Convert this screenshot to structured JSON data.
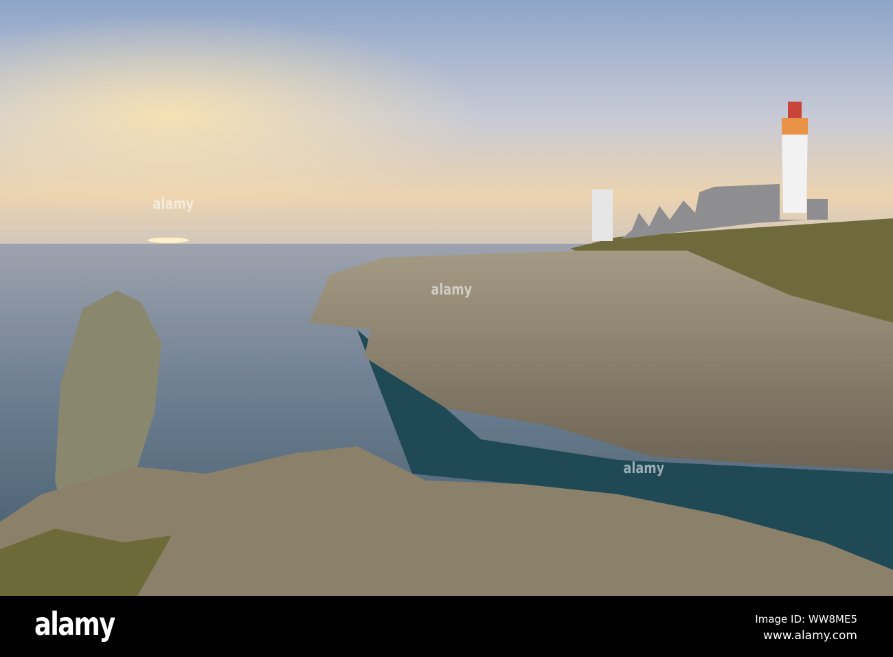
{
  "footer": {
    "logo": "alamy",
    "image_id": "Image ID: WW8ME5",
    "url": "www.alamy.com"
  },
  "watermark": "alamy",
  "colors": {
    "sky_top": "#8fa6c8",
    "sun": "#f4c98a",
    "sea": "#5d7185",
    "cove": "#1f4a55",
    "rock": "#8c8370",
    "grass": "#6f6a3c"
  }
}
